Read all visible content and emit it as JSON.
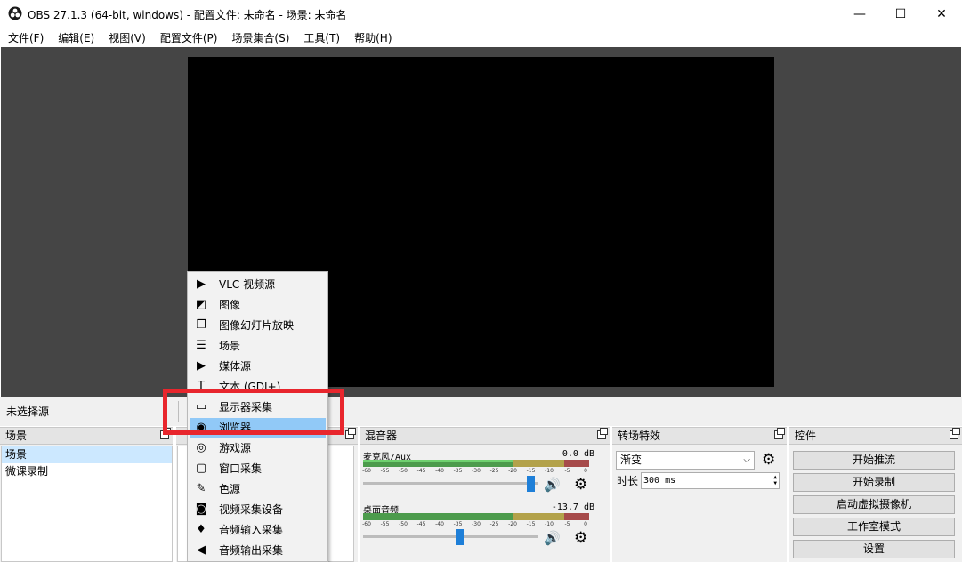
{
  "window": {
    "title": "OBS 27.1.3 (64-bit, windows) - 配置文件: 未命名 - 场景: 未命名",
    "minimize": "—",
    "maximize": "☐",
    "close": "✕"
  },
  "menu": [
    "文件(F)",
    "编辑(E)",
    "视图(V)",
    "配置文件(P)",
    "场景集合(S)",
    "工具(T)",
    "帮助(H)"
  ],
  "source_bar": {
    "label": "未选择源"
  },
  "scenes": {
    "title": "场景",
    "items": [
      "场景",
      "微课录制"
    ]
  },
  "mixer": {
    "title": "混音器",
    "ticks": [
      "-60",
      "-55",
      "-50",
      "-45",
      "-40",
      "-35",
      "-30",
      "-25",
      "-20",
      "-15",
      "-10",
      "-5",
      "0"
    ],
    "tracks": [
      {
        "name": "麦克风/Aux",
        "db": "0.0 dB",
        "level": 0.66,
        "fader": 0.96
      },
      {
        "name": "桌面音频",
        "db": "-13.7 dB",
        "level": 0.0,
        "fader": 0.55
      }
    ]
  },
  "transitions": {
    "title": "转场特效",
    "selected": "渐变",
    "duration_label": "时长",
    "duration_value": "300 ms"
  },
  "controls": {
    "title": "控件",
    "buttons": [
      "开始推流",
      "开始录制",
      "启动虚拟摄像机",
      "工作室模式",
      "设置"
    ]
  },
  "context_menu": {
    "items": [
      {
        "label": "VLC 视频源",
        "icon": "play-icon"
      },
      {
        "label": "图像",
        "icon": "image-icon"
      },
      {
        "label": "图像幻灯片放映",
        "icon": "slideshow-icon"
      },
      {
        "label": "场景",
        "icon": "list-icon"
      },
      {
        "label": "媒体源",
        "icon": "play-icon"
      },
      {
        "label": "文本 (GDI+)",
        "icon": "text-icon"
      },
      {
        "label": "显示器采集",
        "icon": "monitor-icon"
      },
      {
        "label": "浏览器",
        "icon": "globe-icon"
      },
      {
        "label": "游戏源",
        "icon": "gamepad-icon"
      },
      {
        "label": "窗口采集",
        "icon": "window-icon"
      },
      {
        "label": "色源",
        "icon": "brush-icon"
      },
      {
        "label": "视频采集设备",
        "icon": "camera-icon"
      },
      {
        "label": "音频输入采集",
        "icon": "microphone-icon"
      },
      {
        "label": "音频输出采集",
        "icon": "speaker-icon"
      }
    ],
    "highlighted_index": 7
  },
  "colors": {
    "highlight": "#91c9f7",
    "annotation": "#e8262d",
    "fader": "#1e7fd8"
  }
}
